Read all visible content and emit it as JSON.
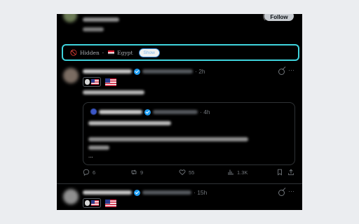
{
  "top_card": {
    "follow_label": "Follow"
  },
  "banner": {
    "ban_icon": "🚫",
    "hidden_label": "Hidden",
    "separator": "·",
    "country": "Egypt",
    "show_label": "Show"
  },
  "post1": {
    "time": "· 2h",
    "more": "···",
    "quote": {
      "time": "· 4h",
      "ellipsis": "..."
    },
    "actions": {
      "replies": "6",
      "reposts": "9",
      "likes": "55",
      "views": "1.3K"
    }
  },
  "post2": {
    "time": "· 15h",
    "more": "···"
  },
  "colors": {
    "accent": "#1d9bf0",
    "highlight": "#3fd3dc",
    "background": "#000000"
  }
}
